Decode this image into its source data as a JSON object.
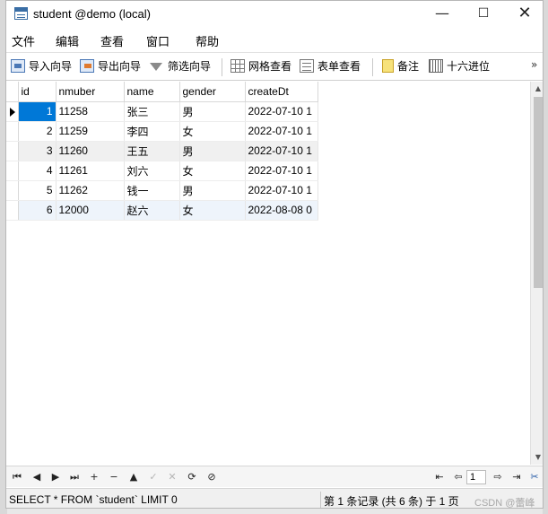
{
  "window": {
    "title": "student @demo (local)",
    "controls": {
      "minimize": "—",
      "maximize": "☐",
      "close": "✕"
    }
  },
  "menu": [
    "文件",
    "编辑",
    "查看",
    "窗口",
    "帮助"
  ],
  "toolbar": {
    "import_wizard": "导入向导",
    "export_wizard": "导出向导",
    "filter_wizard": "筛选向导",
    "grid_view": "网格查看",
    "form_view": "表单查看",
    "memo": "备注",
    "hex": "十六进位",
    "more": "»"
  },
  "table": {
    "columns": [
      "id",
      "nmuber",
      "name",
      "gender",
      "createDt"
    ],
    "rows": [
      {
        "id": "1",
        "nmuber": "11258",
        "name": "张三",
        "gender": "男",
        "createDt": "2022-07-10 1"
      },
      {
        "id": "2",
        "nmuber": "11259",
        "name": "李四",
        "gender": "女",
        "createDt": "2022-07-10 1"
      },
      {
        "id": "3",
        "nmuber": "11260",
        "name": "王五",
        "gender": "男",
        "createDt": "2022-07-10 1"
      },
      {
        "id": "4",
        "nmuber": "11261",
        "name": "刘六",
        "gender": "女",
        "createDt": "2022-07-10 1"
      },
      {
        "id": "5",
        "nmuber": "11262",
        "name": "钱一",
        "gender": "男",
        "createDt": "2022-07-10 1"
      },
      {
        "id": "6",
        "nmuber": "12000",
        "name": "赵六",
        "gender": "女",
        "createDt": "2022-08-08 0"
      }
    ],
    "selected_row": 1,
    "selected_column": "id"
  },
  "navigation": {
    "first": "⏮",
    "prev": "◀",
    "next": "▶",
    "last": "⏭",
    "add": "+",
    "delete": "−",
    "up": "▲",
    "apply": "✓",
    "cancel": "✕",
    "refresh": "⟳",
    "stop": "⊘",
    "page_first": "⇤",
    "page_prev": "⇦",
    "page_number": "1",
    "page_next": "⇨",
    "page_last": "⇥"
  },
  "status": {
    "sql": "SELECT * FROM `student` LIMIT 0",
    "records": "第 1 条记录 (共 6 条) 于 1 页",
    "watermark": "CSDN @蕾峰"
  },
  "colors": {
    "selection": "#0078d7",
    "alt_row": "#f0f0f0",
    "last_row": "#eef4fb"
  }
}
